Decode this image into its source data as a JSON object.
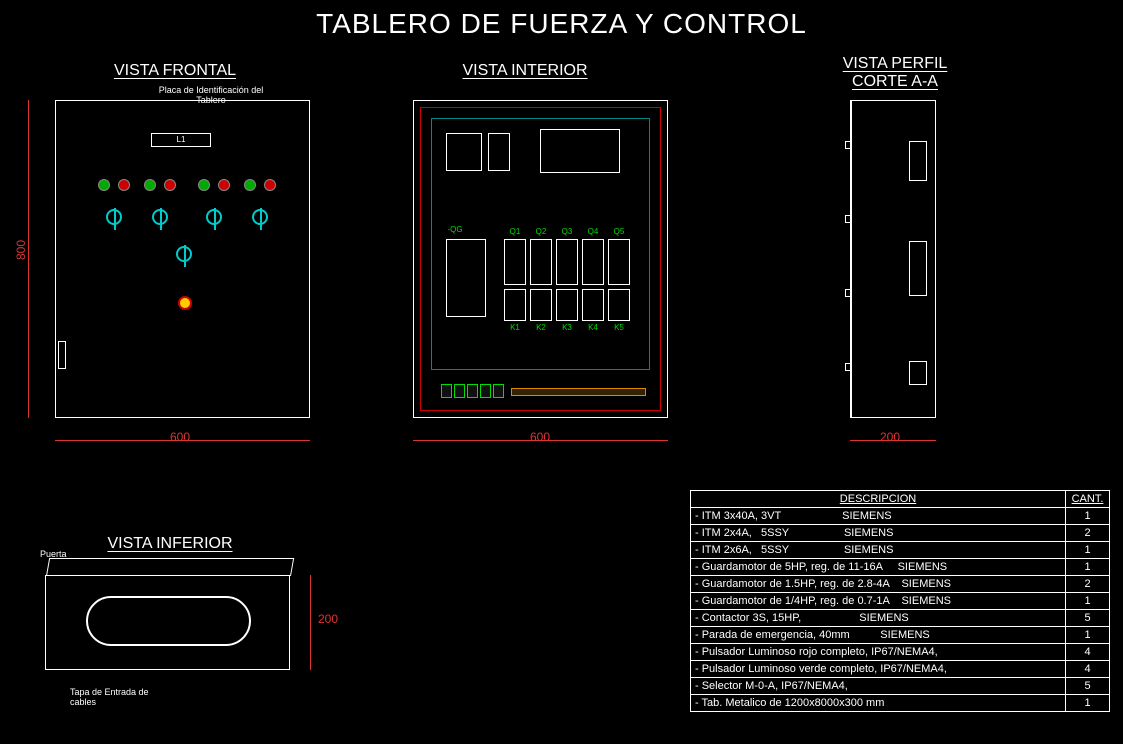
{
  "title": "TABLERO DE FUERZA Y CONTROL",
  "views": {
    "front": "VISTA FRONTAL",
    "interior": "VISTA INTERIOR",
    "profile_line1": "VISTA PERFIL",
    "profile_line2": "CORTE A-A",
    "inferior": "VISTA INFERIOR"
  },
  "notes": {
    "id_plate": "Placa de Identificación del Tablero",
    "id_plate_text": "L1",
    "puerta": "Puerta",
    "tapa": "Tapa de Entrada de cables"
  },
  "interior": {
    "qg": "-QG",
    "q": [
      "Q1",
      "Q2",
      "Q3",
      "Q4",
      "Q5"
    ],
    "k": [
      "K1",
      "K2",
      "K3",
      "K4",
      "K5"
    ]
  },
  "dims": {
    "h800": "800",
    "w600a": "600",
    "w600b": "600",
    "d200": "200",
    "h200": "200"
  },
  "parts_table": {
    "headers": [
      "DESCRIPCION",
      "CANT."
    ],
    "rows": [
      [
        "- ITM 3x40A, 3VT                    SIEMENS",
        "1"
      ],
      [
        "- ITM 2x4A,   5SSY                  SIEMENS",
        "2"
      ],
      [
        "- ITM 2x6A,   5SSY                  SIEMENS",
        "1"
      ],
      [
        "- Guardamotor de 5HP, reg. de 11-16A     SIEMENS",
        "1"
      ],
      [
        "- Guardamotor de 1.5HP, reg. de 2.8-4A    SIEMENS",
        "2"
      ],
      [
        "- Guardamotor de 1/4HP, reg. de 0.7-1A    SIEMENS",
        "1"
      ],
      [
        "- Contactor 3S, 15HP,                   SIEMENS",
        "5"
      ],
      [
        "- Parada de emergencia, 40mm          SIEMENS",
        "1"
      ],
      [
        "- Pulsador Luminoso rojo completo, IP67/NEMA4,",
        "4"
      ],
      [
        "- Pulsador Luminoso verde completo, IP67/NEMA4,",
        "4"
      ],
      [
        "- Selector M-0-A, IP67/NEMA4,",
        "5"
      ],
      [
        "- Tab. Metalico de 1200x8000x300 mm",
        "1"
      ]
    ]
  }
}
